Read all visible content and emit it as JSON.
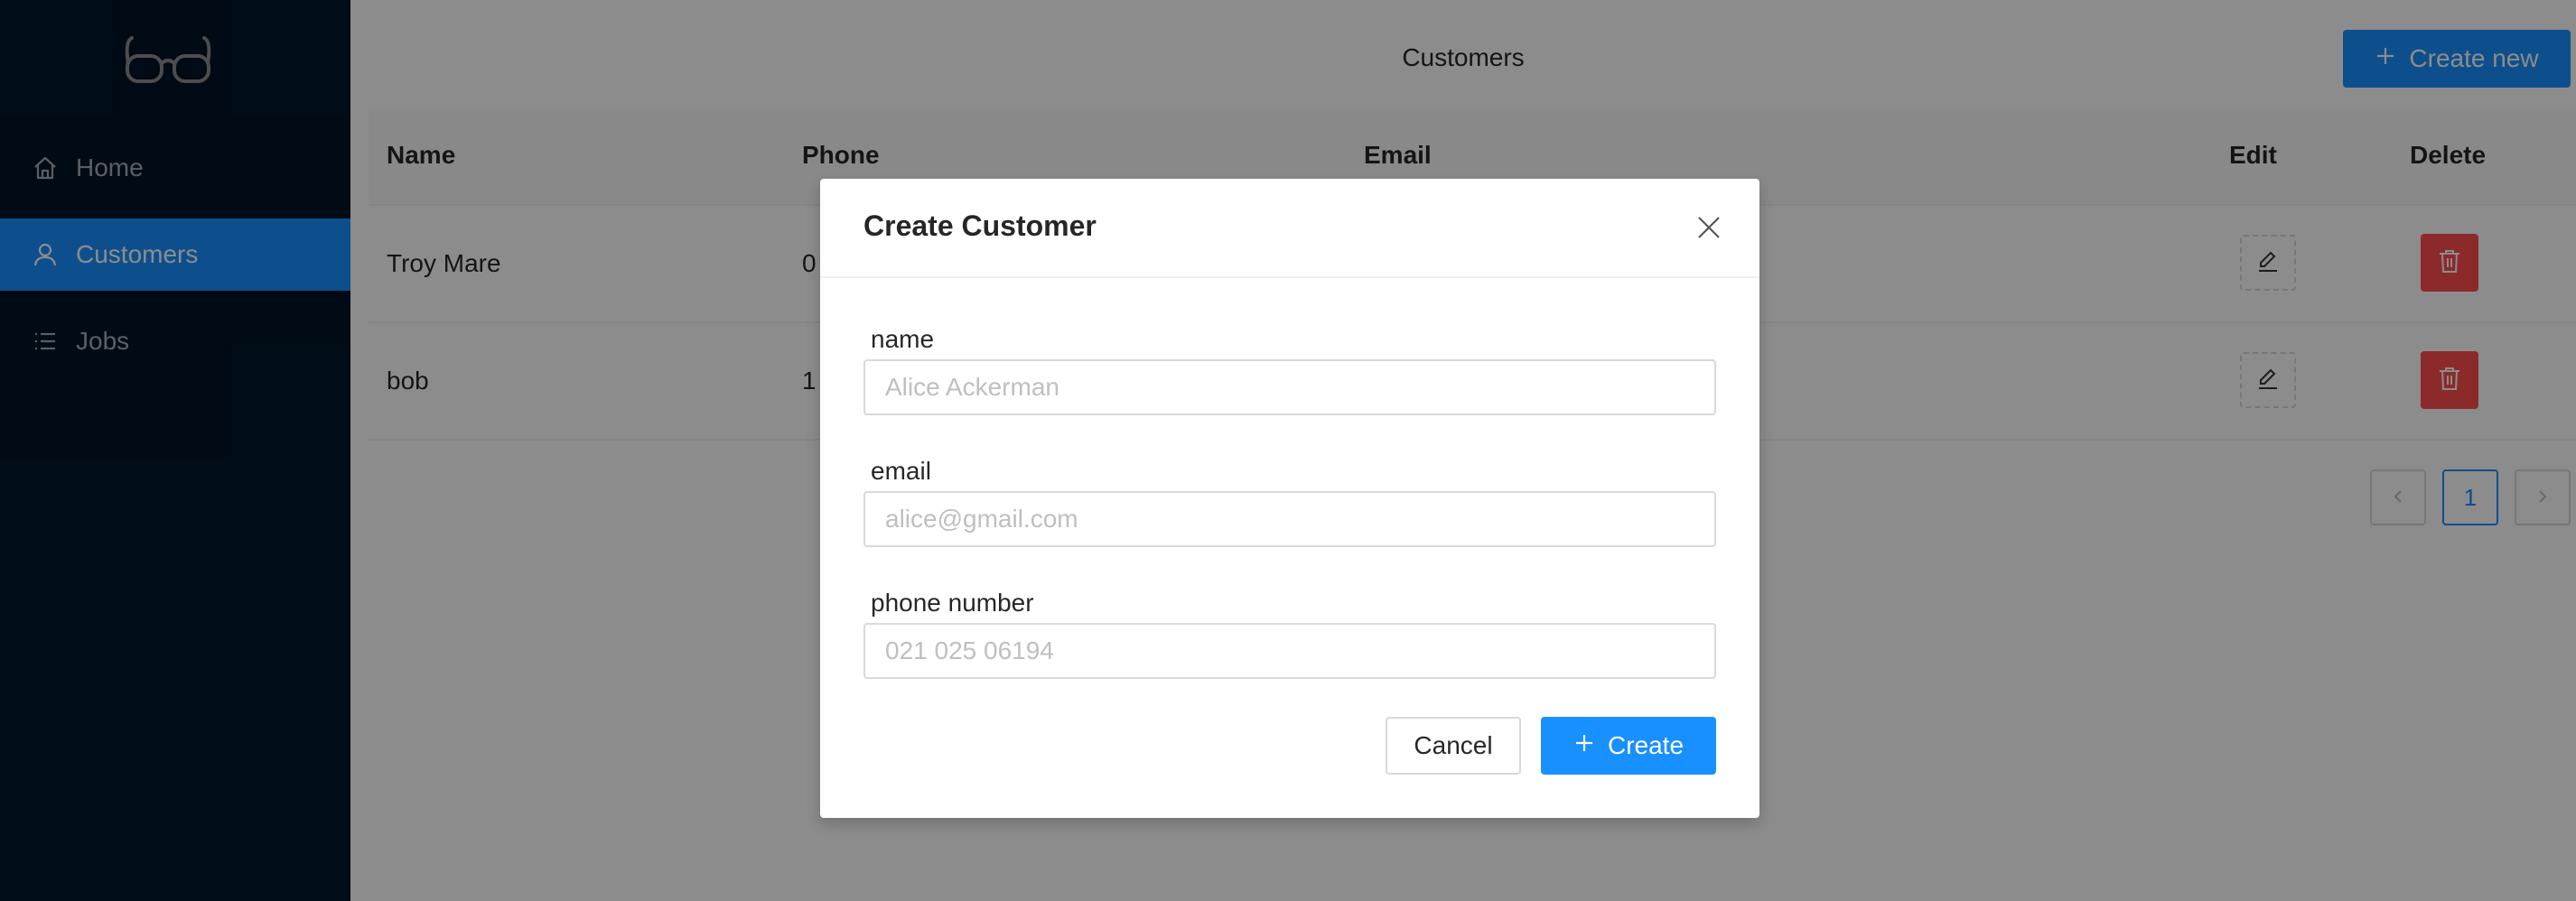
{
  "sidebar": {
    "logo_icon": "glasses-icon",
    "items": [
      {
        "label": "Home",
        "icon": "home-icon"
      },
      {
        "label": "Customers",
        "icon": "user-icon",
        "active": true
      },
      {
        "label": "Jobs",
        "icon": "list-icon"
      }
    ]
  },
  "header": {
    "title": "Customers",
    "create_new_label": "Create new"
  },
  "table": {
    "columns": [
      "Name",
      "Phone",
      "Email",
      "Edit",
      "Delete"
    ],
    "rows": [
      {
        "name": "Troy Mare",
        "phone": "0"
      },
      {
        "name": "bob",
        "phone": "1"
      }
    ]
  },
  "pagination": {
    "current_page": "1",
    "prev_icon": "chevron-left-icon",
    "next_icon": "chevron-right-icon"
  },
  "modal": {
    "title": "Create Customer",
    "fields": [
      {
        "label": "name",
        "placeholder": "Alice Ackerman"
      },
      {
        "label": "email",
        "placeholder": "alice@gmail.com"
      },
      {
        "label": "phone number",
        "placeholder": "021 025 06194"
      }
    ],
    "cancel_label": "Cancel",
    "create_label": "Create"
  },
  "colors": {
    "sidebar_bg": "#001529",
    "primary": "#1890ff",
    "danger": "#ff4d4f"
  }
}
